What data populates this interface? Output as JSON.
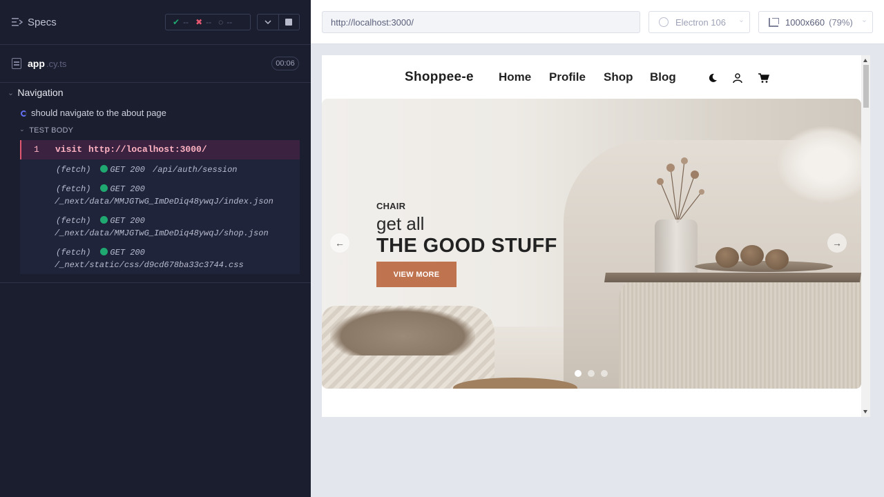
{
  "runner": {
    "specs_title": "Specs",
    "stats": {
      "passed": "--",
      "failed": "--",
      "pending": "--"
    },
    "file": {
      "name": "app",
      "ext": ".cy.ts",
      "duration": "00:06"
    },
    "suite": "Navigation",
    "test_title": "should navigate to the about page",
    "test_body_label": "TEST BODY",
    "commands": [
      {
        "num": "1",
        "name": "visit",
        "message": "http://localhost:3000/"
      }
    ],
    "logs": [
      {
        "type": "(fetch)",
        "method_status": "GET 200",
        "path": "/api/auth/session"
      },
      {
        "type": "(fetch)",
        "method_status": "GET 200",
        "path": "/_next/data/MMJGTwG_ImDeDiq48ywqJ/index.json"
      },
      {
        "type": "(fetch)",
        "method_status": "GET 200",
        "path": "/_next/data/MMJGTwG_ImDeDiq48ywqJ/shop.json"
      },
      {
        "type": "(fetch)",
        "method_status": "GET 200",
        "path": "/_next/static/css/d9cd678ba33c3744.css"
      }
    ],
    "status_colors": {
      "pass": "#1fa971",
      "fail": "#e45770",
      "running": "#6470f3"
    }
  },
  "aut": {
    "url": "http://localhost:3000/",
    "browser": "Electron 106",
    "viewport": "1000x660",
    "scale": "(79%)"
  },
  "site": {
    "brand": "Shoppee-e",
    "nav": [
      "Home",
      "Profile",
      "Shop",
      "Blog"
    ],
    "icons": [
      "moon-icon",
      "user-icon",
      "cart-icon"
    ],
    "hero": {
      "category": "CHAIR",
      "line": "get all",
      "title": "THE GOOD STUFF",
      "button": "VIEW MORE",
      "slide_count": 3,
      "active_slide": 1,
      "accent": "#c0734f"
    }
  }
}
